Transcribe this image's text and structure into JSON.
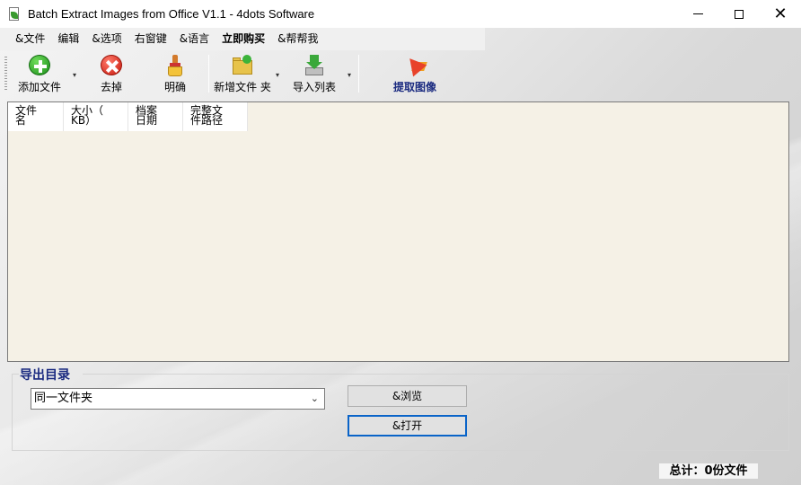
{
  "window": {
    "title": "Batch Extract Images from Office V1.1 - 4dots Software",
    "controls": {
      "minimize": "—",
      "maximize": "☐",
      "close": "✕"
    }
  },
  "menu": {
    "items": [
      {
        "label": "&文件",
        "bold": false
      },
      {
        "label": "编辑",
        "bold": false
      },
      {
        "label": "&选项",
        "bold": false
      },
      {
        "label": "右窗键",
        "bold": false
      },
      {
        "label": "&语言",
        "bold": false
      },
      {
        "label": "立即购买",
        "bold": true
      },
      {
        "label": "&帮帮我",
        "bold": false
      }
    ]
  },
  "toolbar": {
    "add_files": {
      "label": "添加文件",
      "icon": "add-icon"
    },
    "remove": {
      "label": "去掉",
      "icon": "remove-icon"
    },
    "clear": {
      "label": "明确",
      "icon": "broom-icon"
    },
    "add_folder": {
      "label": "新增文件 夹",
      "icon": "folder-add-icon"
    },
    "import_list": {
      "label": "导入列表",
      "icon": "import-icon"
    },
    "extract": {
      "label": "提取图像",
      "icon": "extract-icon"
    },
    "dropdown_glyph": "▾"
  },
  "file_list": {
    "columns": [
      {
        "line1": "文件",
        "line2": "名"
      },
      {
        "line1": "大小（",
        "line2": "KB）"
      },
      {
        "line1": "档案",
        "line2": "日期"
      },
      {
        "line1": "完整文",
        "line2": "件路径"
      }
    ],
    "rows": []
  },
  "output": {
    "group_title": "导出目录",
    "folder_select_value": "同一文件夹",
    "browse_label": "&浏览",
    "open_label": "&打开"
  },
  "status": {
    "total_text": "总计：0份文件"
  },
  "colors": {
    "list_bg": "#f5f1e6",
    "accent_blue": "#1a2a80",
    "focus_border": "#0a64c8"
  }
}
